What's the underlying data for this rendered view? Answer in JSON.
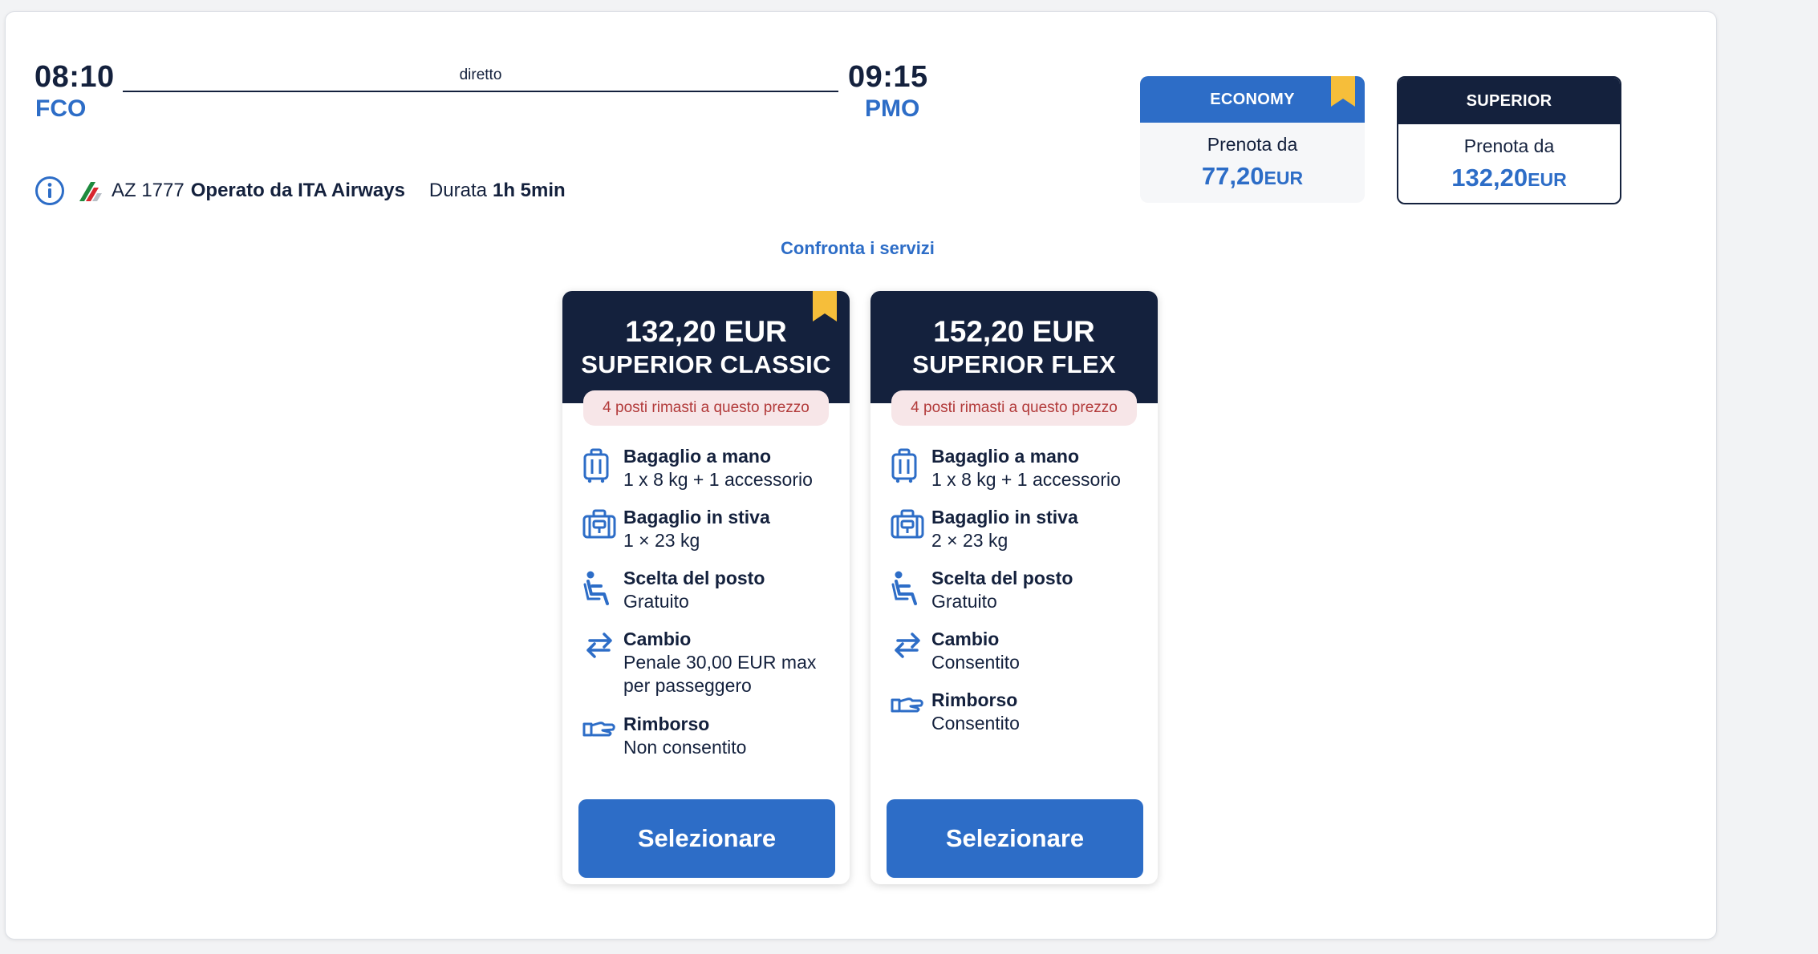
{
  "flight": {
    "departure_time": "08:10",
    "departure_airport": "FCO",
    "arrival_time": "09:15",
    "arrival_airport": "PMO",
    "route_type": "diretto",
    "flight_number": "AZ 1777",
    "operated_by": "Operato da ITA Airways",
    "duration_label": "Durata",
    "duration_value": "1h 5min"
  },
  "cabins": [
    {
      "name": "ECONOMY",
      "from_label": "Prenota da",
      "price": "77,20",
      "currency": "EUR",
      "header_color": "#2d6dc7"
    },
    {
      "name": "SUPERIOR",
      "from_label": "Prenota da",
      "price": "132,20",
      "currency": "EUR",
      "header_color": "#14213d"
    }
  ],
  "compare_link": "Confronta i servizi",
  "fares": [
    {
      "price": "132,20 EUR",
      "name": "SUPERIOR CLASSIC",
      "availability": "4 posti rimasti a questo prezzo",
      "features": [
        {
          "icon": "cabin-bag-icon",
          "title": "Bagaglio a mano",
          "lines": [
            "1 x 8 kg + 1 accessorio"
          ]
        },
        {
          "icon": "checked-bag-icon",
          "title": "Bagaglio in stiva",
          "lines": [
            "1 × 23 kg"
          ]
        },
        {
          "icon": "seat-icon",
          "title": "Scelta del posto",
          "lines": [
            "Gratuito"
          ]
        },
        {
          "icon": "change-arrows-icon",
          "title": "Cambio",
          "lines": [
            "Penale 30,00 EUR max",
            "per passeggero"
          ]
        },
        {
          "icon": "refund-hand-icon",
          "title": "Rimborso",
          "lines": [
            "Non consentito"
          ]
        }
      ],
      "button": "Selezionare"
    },
    {
      "price": "152,20 EUR",
      "name": "SUPERIOR FLEX",
      "availability": "4 posti rimasti a questo prezzo",
      "features": [
        {
          "icon": "cabin-bag-icon",
          "title": "Bagaglio a mano",
          "lines": [
            "1 x 8 kg + 1 accessorio"
          ]
        },
        {
          "icon": "checked-bag-icon",
          "title": "Bagaglio in stiva",
          "lines": [
            "2 × 23 kg"
          ]
        },
        {
          "icon": "seat-icon",
          "title": "Scelta del posto",
          "lines": [
            "Gratuito"
          ]
        },
        {
          "icon": "change-arrows-icon",
          "title": "Cambio",
          "lines": [
            "Consentito"
          ]
        },
        {
          "icon": "refund-hand-icon",
          "title": "Rimborso",
          "lines": [
            "Consentito"
          ]
        }
      ],
      "button": "Selezionare"
    }
  ],
  "colors": {
    "navy": "#14213d",
    "accent_blue": "#2d6dc7",
    "bookmark_yellow": "#f6be3a",
    "availability_bg": "#f7e6e8",
    "availability_text": "#b23a3a"
  }
}
